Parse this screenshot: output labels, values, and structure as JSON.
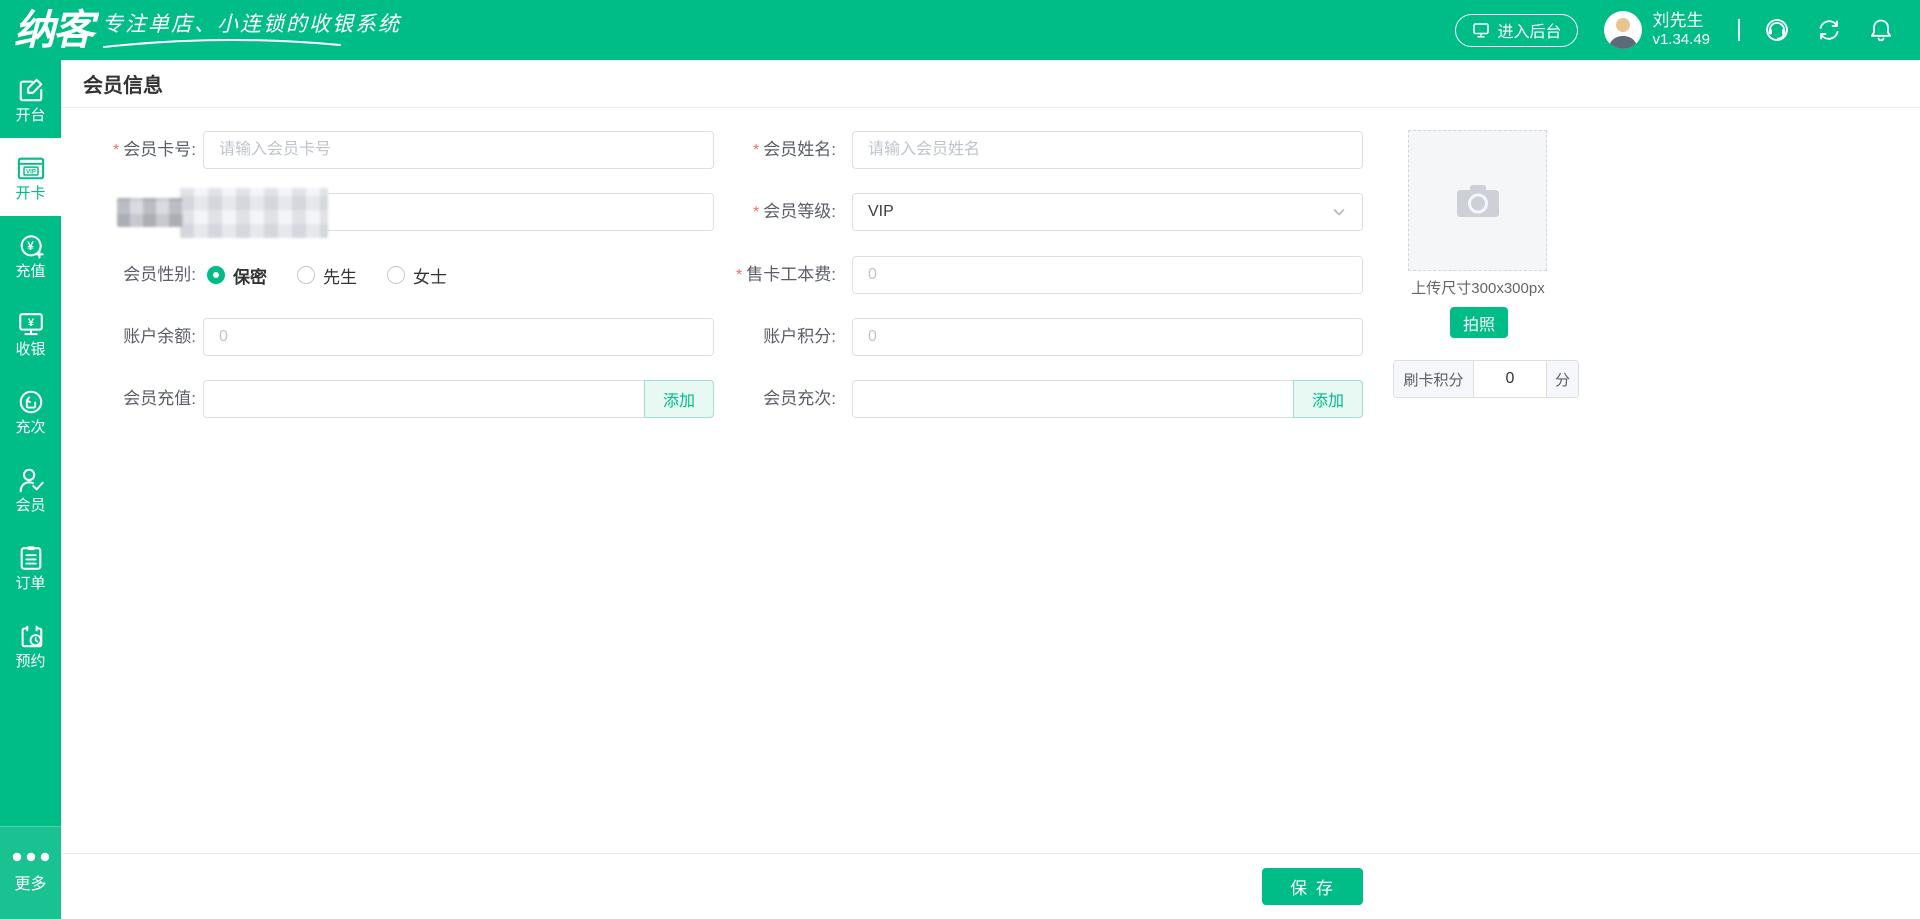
{
  "topbar": {
    "logo": "纳客",
    "tagline": "专注单店、小连锁的收银系统",
    "backstage_button": "进入后台",
    "user_name": "刘先生",
    "version": "v1.34.49"
  },
  "sidebar": {
    "items": [
      {
        "label": "开台",
        "icon": "open-table-icon",
        "active": false
      },
      {
        "label": "开卡",
        "icon": "vip-card-icon",
        "active": true
      },
      {
        "label": "充值",
        "icon": "recharge-icon",
        "active": false
      },
      {
        "label": "收银",
        "icon": "cashier-icon",
        "active": false
      },
      {
        "label": "充次",
        "icon": "recharge-times-icon",
        "active": false
      },
      {
        "label": "会员",
        "icon": "member-icon",
        "active": false
      },
      {
        "label": "订单",
        "icon": "order-icon",
        "active": false
      },
      {
        "label": "预约",
        "icon": "reservation-icon",
        "active": false
      }
    ],
    "more": {
      "label": "更多",
      "icon": "more-dots-icon"
    }
  },
  "page": {
    "title": "会员信息"
  },
  "form": {
    "required_mark": "*",
    "card_no": {
      "label": "会员卡号:",
      "required": true,
      "placeholder": "请输入会员卡号"
    },
    "name": {
      "label": "会员姓名:",
      "required": true,
      "placeholder": "请输入会员姓名"
    },
    "redacted_field": {
      "redacted": true
    },
    "level": {
      "label": "会员等级:",
      "required": true,
      "value": "VIP"
    },
    "gender": {
      "label": "会员性别:",
      "options": [
        "保密",
        "先生",
        "女士"
      ],
      "selected": "保密"
    },
    "card_fee": {
      "label": "售卡工本费:",
      "required": true,
      "placeholder": "0"
    },
    "balance": {
      "label": "账户余额:",
      "placeholder": "0"
    },
    "points": {
      "label": "账户积分:",
      "placeholder": "0"
    },
    "recharge": {
      "label": "会员充值:",
      "add_button": "添加"
    },
    "recharge_times": {
      "label": "会员充次:",
      "add_button": "添加"
    }
  },
  "photo": {
    "hint": "上传尺寸300x300px",
    "take_photo_button": "拍照",
    "swipe_points": {
      "label": "刷卡积分",
      "value": "0",
      "unit": "分"
    }
  },
  "footer": {
    "save_button": "保 存"
  },
  "colors": {
    "brand_green": "#00BC86",
    "light_green": "#e7f9f2",
    "border": "#dcdfe6",
    "required_red": "#f56c6c",
    "placeholder": "#bfc4cc"
  }
}
